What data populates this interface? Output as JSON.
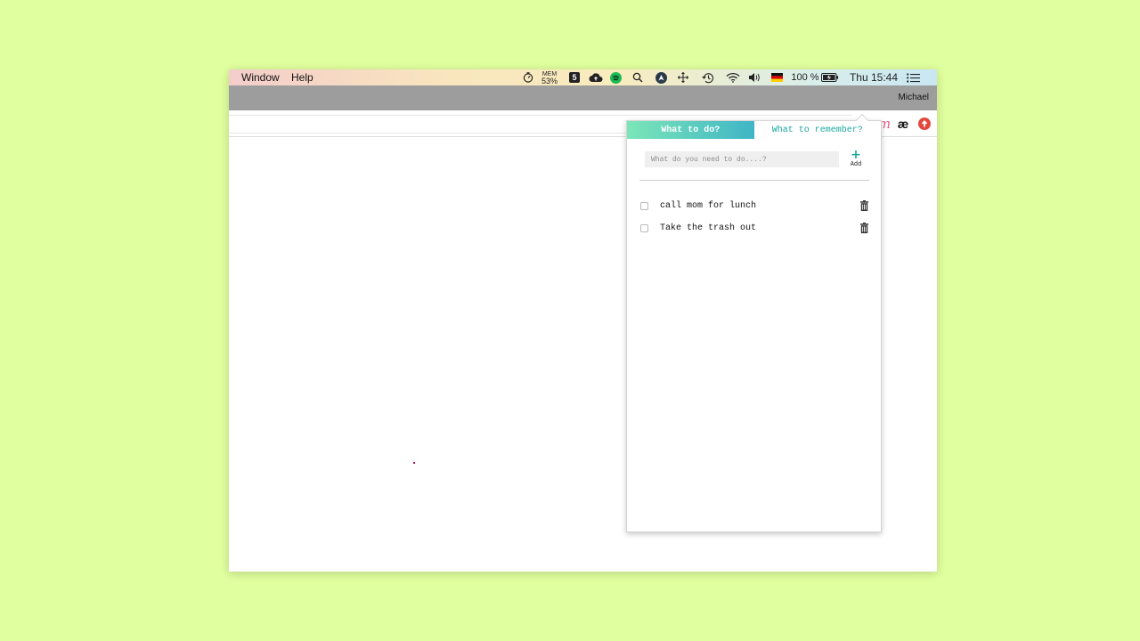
{
  "menubar": {
    "menus": [
      "Window",
      "Help"
    ],
    "mem_label": "MEM",
    "mem_value": "53%",
    "badge_5": "5",
    "battery": "100 %",
    "clock": "Thu 15:44"
  },
  "chrome": {
    "profile_name": "Michael",
    "ext_ae": "æ"
  },
  "popup": {
    "tabs": [
      {
        "label": "What to do?",
        "active": true
      },
      {
        "label": "What to remember?",
        "active": false
      }
    ],
    "input": {
      "placeholder": "What do you need to do....?",
      "value": ""
    },
    "add_label": "Add",
    "todos": [
      {
        "text": "call mom for lunch",
        "done": false
      },
      {
        "text": "Take the trash out",
        "done": false
      }
    ]
  },
  "colors": {
    "background": "#e0ff9e",
    "tab_gradient_start": "#7be6b8",
    "tab_gradient_end": "#3fb5c6",
    "accent_teal": "#1aa6a0"
  }
}
